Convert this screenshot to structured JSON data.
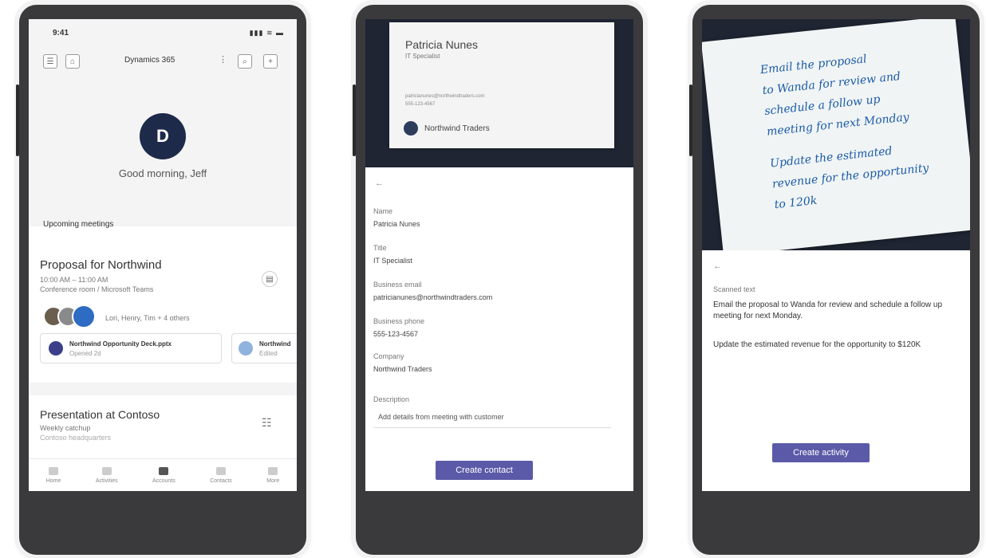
{
  "phone1": {
    "status": {
      "time": "9:41",
      "signal": "▮▮▮ ≋ ▬"
    },
    "topbar": {
      "title": "Dynamics 365"
    },
    "greeting": "Good morning, Jeff",
    "section_label": "Upcoming meetings",
    "meeting1": {
      "title": "Proposal for Northwind",
      "time": "10:00 AM – 11:00 AM",
      "location": "Conference room / Microsoft Teams",
      "attendees": "Lori, Henry, Tim + 4 others",
      "docs": [
        {
          "name": "Northwind Opportunity Deck.pptx",
          "meta": "Opened 2d"
        },
        {
          "name": "Northwind",
          "meta": "Edited"
        }
      ]
    },
    "meeting2": {
      "title": "Presentation at Contoso",
      "subtitle": "Weekly catchup",
      "location": "Contoso headquarters"
    },
    "nav": [
      "Home",
      "Activities",
      "Accounts",
      "Contacts",
      "More"
    ]
  },
  "phone2": {
    "card": {
      "name": "Patricia Nunes",
      "title": "IT Specialist",
      "email_line": "patricianunes@northwindtraders.com",
      "phone_line": "555-123-4567",
      "company": "Northwind Traders"
    },
    "fields": [
      {
        "label": "Name",
        "value": "Patricia Nunes"
      },
      {
        "label": "Title",
        "value": "IT Specialist"
      },
      {
        "label": "Business email",
        "value": "patricianunes@northwindtraders.com"
      },
      {
        "label": "Business phone",
        "value": "555-123-4567"
      },
      {
        "label": "Company",
        "value": "Northwind Traders"
      },
      {
        "label": "Description",
        "value": "Add details from meeting with customer"
      }
    ],
    "back": "←",
    "action": "Create contact"
  },
  "phone3": {
    "handwriting": [
      "Email the proposal",
      "to Wanda for review and",
      "schedule a follow up",
      "meeting for next Monday",
      "Update the estimated",
      "revenue for the opportunity",
      "to 120k"
    ],
    "back": "←",
    "label": "Scanned text",
    "ocr1": "Email the proposal to Wanda for review and schedule a follow up meeting for next Monday.",
    "ocr2": "Update the estimated revenue for the opportunity to $120K",
    "action": "Create activity"
  },
  "colors": {
    "brand": "#5b5aa8",
    "logo": "#1e2a4a",
    "ink": "#1a5aa8"
  }
}
